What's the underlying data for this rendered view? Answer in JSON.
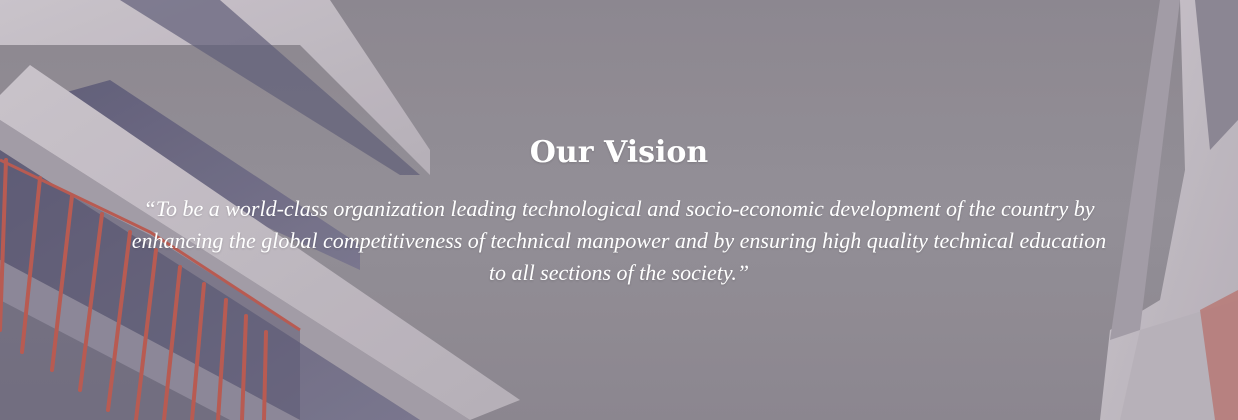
{
  "vision": {
    "title": "Our Vision",
    "statement": "“To be a world-class organization leading technological and socio-economic development of the country by enhancing the global competitiveness of technical manpower and by ensuring high quality technical education to all sections of the society.”"
  },
  "colors": {
    "sky": "#938f97",
    "building_face": "#cbc6cc",
    "window": "#6f6d86",
    "railing": "#c05a4d",
    "text": "#ffffff"
  }
}
